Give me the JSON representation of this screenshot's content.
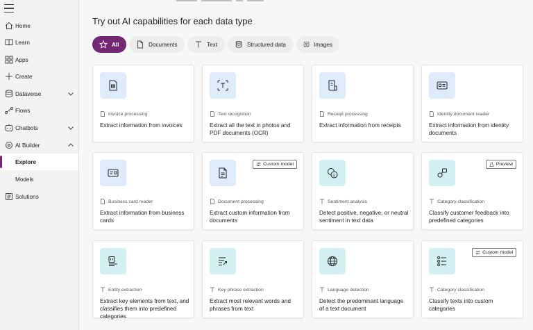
{
  "sidebar": {
    "items": [
      {
        "label": "Home",
        "icon": "home-icon"
      },
      {
        "label": "Learn",
        "icon": "book-icon"
      },
      {
        "label": "Apps",
        "icon": "apps-icon"
      },
      {
        "label": "Create",
        "icon": "plus-icon"
      },
      {
        "label": "Dataverse",
        "icon": "database-icon"
      },
      {
        "label": "Flows",
        "icon": "flow-icon"
      },
      {
        "label": "Chatbots",
        "icon": "chatbot-icon"
      },
      {
        "label": "AI Builder",
        "icon": "ai-builder-icon"
      },
      {
        "label": "Explore"
      },
      {
        "label": "Models"
      },
      {
        "label": "Solutions",
        "icon": "solutions-icon"
      }
    ]
  },
  "main": {
    "title": "Try out AI capabilities for each data type",
    "filters": [
      {
        "label": "All"
      },
      {
        "label": "Documents"
      },
      {
        "label": "Text"
      },
      {
        "label": "Structured data"
      },
      {
        "label": "Images"
      }
    ],
    "cards": [
      {
        "category": "Invoice processing",
        "description": "Extract information from invoices",
        "tag": ""
      },
      {
        "category": "Text recognition",
        "description": "Extract all the text in photos and PDF documents (OCR)",
        "tag": ""
      },
      {
        "category": "Receipt processing",
        "description": "Extract information from receipts",
        "tag": ""
      },
      {
        "category": "Identity document reader",
        "description": "Extract information from identity documents",
        "tag": ""
      },
      {
        "category": "Business card reader",
        "description": "Extract information from business cards",
        "tag": ""
      },
      {
        "category": "Document processing",
        "description": "Extract custom information from documents",
        "tag": "Custom model"
      },
      {
        "category": "Sentiment analysis",
        "description": "Detect positive, negative, or neutral sentiment in text data",
        "tag": ""
      },
      {
        "category": "Category classification",
        "description": "Classify customer feedback into predefined categories",
        "tag": "Preview"
      },
      {
        "category": "Entity extraction",
        "description": "Extract key elements from text, and classifies them into predefined categories",
        "tag": ""
      },
      {
        "category": "Key phrase extraction",
        "description": "Extract most relevant words and phrases from text",
        "tag": ""
      },
      {
        "category": "Language detection",
        "description": "Detect the predominant language of a text document",
        "tag": ""
      },
      {
        "category": "Category classification",
        "description": "Classify texts into custom categories",
        "tag": "Custom model"
      }
    ]
  },
  "colors": {
    "accent": "#742774",
    "tile_blue": "#deebfb",
    "tile_cyan": "#d3f1f3"
  }
}
